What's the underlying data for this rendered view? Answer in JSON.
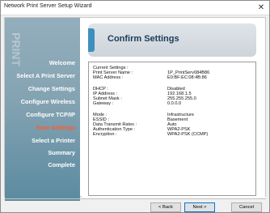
{
  "window": {
    "title": "Network Print Server Setup Wizard",
    "close_glyph": "✕"
  },
  "sidebar": {
    "watermark": "PRINT",
    "steps": [
      {
        "label": "Welcome"
      },
      {
        "label": "Select A Print Server"
      },
      {
        "label": "Change Settings"
      },
      {
        "label": "Configure Wireless"
      },
      {
        "label": "Configure TCP/IP"
      },
      {
        "label": "Save Settings",
        "current": true
      },
      {
        "label": "Select a Printer"
      },
      {
        "label": "Summary"
      },
      {
        "label": "Complete"
      }
    ]
  },
  "header": {
    "title": "Confirm Settings"
  },
  "settings": {
    "current_heading": "Current Settings :",
    "print_server_name_label": "Print Server Name :",
    "print_server_name_value": "1P_PrintServ084B86",
    "mac_label": "MAC Address :",
    "mac_value": "E0:BF:EC:08:4B:86",
    "dhcp_label": "DHCP :",
    "dhcp_value": "Disabled",
    "ip_label": "IP Address :",
    "ip_value": "192.168.1.5",
    "subnet_label": "Subnet Mask :",
    "subnet_value": "255.255.255.0",
    "gateway_label": "Gateway :",
    "gateway_value": "0.0.0.0",
    "mode_label": "Mode :",
    "mode_value": "Infrastructure",
    "essid_label": "ESSID :",
    "essid_value": "Basement",
    "rate_label": "Data Transmit Rates :",
    "rate_value": "Auto",
    "auth_label": "Authentication Type :",
    "auth_value": "WPA2-PSK",
    "enc_label": "Encryption :",
    "enc_value": "WPA2-PSK (CCMP)"
  },
  "buttons": {
    "back": "< Back",
    "next": "Next >",
    "cancel": "Cancel"
  },
  "colors": {
    "current_step": "#ff5a2a",
    "accent": "#3d8fbe",
    "sidebar_top": "#93aebc",
    "sidebar_bottom": "#5b8ba0"
  }
}
